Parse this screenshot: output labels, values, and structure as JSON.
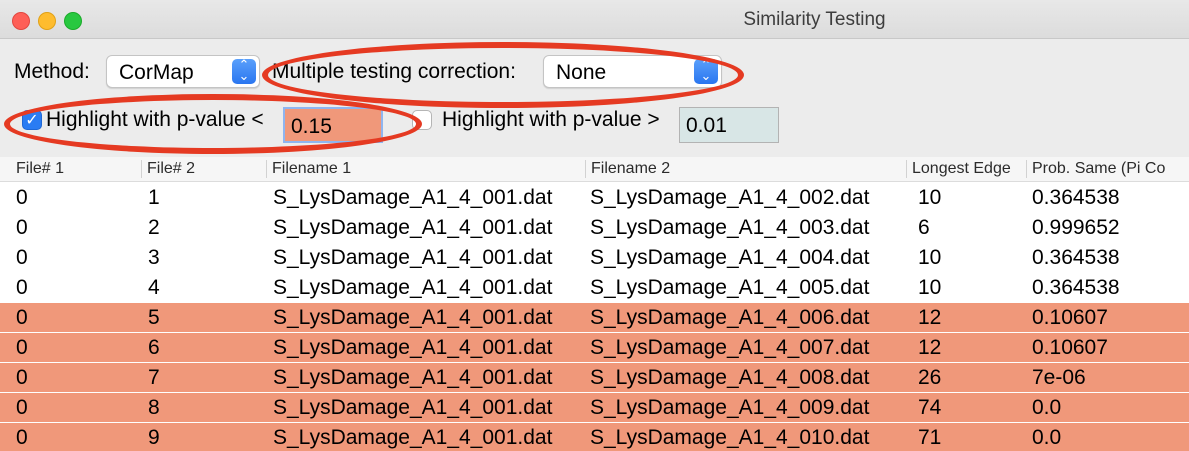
{
  "window": {
    "title": "Similarity Testing"
  },
  "controls": {
    "method_label": "Method:",
    "method_value": "CorMap",
    "correction_label": "Multiple testing correction:",
    "correction_value": "None",
    "highlight_lt_label": "Highlight with p-value <",
    "highlight_lt_checked": true,
    "highlight_lt_value": "0.15",
    "highlight_gt_label": "Highlight with p-value >",
    "highlight_gt_checked": false,
    "highlight_gt_value": "0.01",
    "highlight_lt_color": "#f0987a",
    "highlight_gt_color": "#d8e6e6",
    "annotation_color": "#e53a22"
  },
  "table": {
    "columns": [
      "File# 1",
      "File# 2",
      "Filename 1",
      "Filename 2",
      "Longest Edge",
      "Prob. Same (Pi Co"
    ],
    "rows": [
      {
        "f1": "0",
        "f2": "1",
        "fn1": "S_LysDamage_A1_4_001.dat",
        "fn2": "S_LysDamage_A1_4_002.dat",
        "edge": "10",
        "prob": "0.364538"
      },
      {
        "f1": "0",
        "f2": "2",
        "fn1": "S_LysDamage_A1_4_001.dat",
        "fn2": "S_LysDamage_A1_4_003.dat",
        "edge": "6",
        "prob": "0.999652"
      },
      {
        "f1": "0",
        "f2": "3",
        "fn1": "S_LysDamage_A1_4_001.dat",
        "fn2": "S_LysDamage_A1_4_004.dat",
        "edge": "10",
        "prob": "0.364538"
      },
      {
        "f1": "0",
        "f2": "4",
        "fn1": "S_LysDamage_A1_4_001.dat",
        "fn2": "S_LysDamage_A1_4_005.dat",
        "edge": "10",
        "prob": "0.364538"
      },
      {
        "f1": "0",
        "f2": "5",
        "fn1": "S_LysDamage_A1_4_001.dat",
        "fn2": "S_LysDamage_A1_4_006.dat",
        "edge": "12",
        "prob": "0.10607"
      },
      {
        "f1": "0",
        "f2": "6",
        "fn1": "S_LysDamage_A1_4_001.dat",
        "fn2": "S_LysDamage_A1_4_007.dat",
        "edge": "12",
        "prob": "0.10607"
      },
      {
        "f1": "0",
        "f2": "7",
        "fn1": "S_LysDamage_A1_4_001.dat",
        "fn2": "S_LysDamage_A1_4_008.dat",
        "edge": "26",
        "prob": "7e-06"
      },
      {
        "f1": "0",
        "f2": "8",
        "fn1": "S_LysDamage_A1_4_001.dat",
        "fn2": "S_LysDamage_A1_4_009.dat",
        "edge": "74",
        "prob": "0.0"
      },
      {
        "f1": "0",
        "f2": "9",
        "fn1": "S_LysDamage_A1_4_001.dat",
        "fn2": "S_LysDamage_A1_4_010.dat",
        "edge": "71",
        "prob": "0.0"
      }
    ]
  }
}
